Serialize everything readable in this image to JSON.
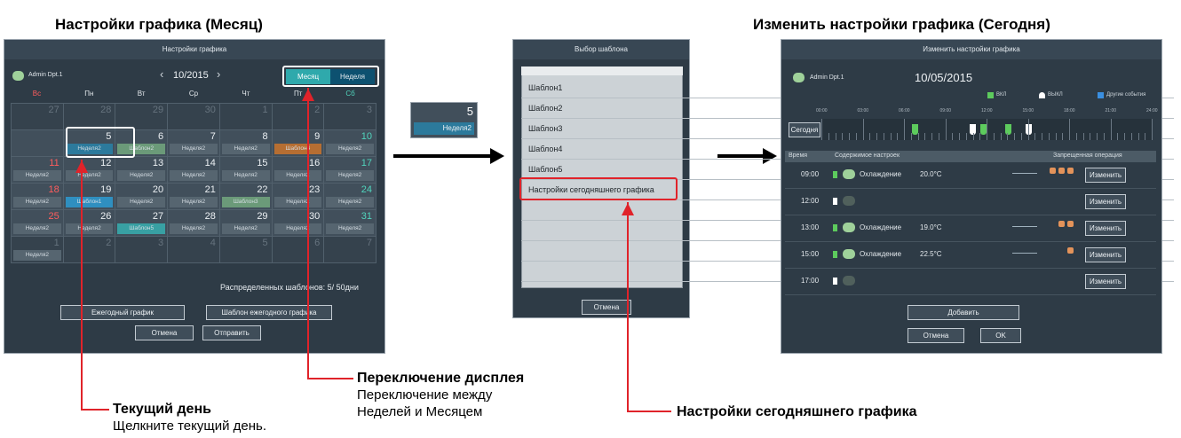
{
  "headings": {
    "month": "Настройки графика (Месяц)",
    "today": "Изменить настройки графика (Сегодня)"
  },
  "cal": {
    "title": "Настройки графика",
    "group": "Admin Dpt.1",
    "month": "10/2015",
    "view_month": "Месяц",
    "view_week": "Неделя",
    "days": [
      "Вс",
      "Пн",
      "Вт",
      "Ср",
      "Чт",
      "Пт",
      "Сб"
    ],
    "footer": "Распределенных шаблонов: 5/ 50дни",
    "btn_yearly": "Ежегодный график",
    "btn_template": "Шаблон ежегодного графика",
    "btn_cancel": "Отмена",
    "btn_send": "Отправить",
    "cells": [
      {
        "n": "27",
        "dim": true
      },
      {
        "n": "28",
        "dim": true
      },
      {
        "n": "29",
        "dim": true
      },
      {
        "n": "30",
        "dim": true
      },
      {
        "n": "1",
        "dim": true
      },
      {
        "n": "2",
        "dim": true
      },
      {
        "n": "3",
        "dim": true
      },
      {
        "n": ""
      },
      {
        "n": "5",
        "label": "Неделя2"
      },
      {
        "n": "6",
        "label": "Шаблон2",
        "c": "green"
      },
      {
        "n": "7",
        "label": "Неделя2"
      },
      {
        "n": "8",
        "label": "Неделя2"
      },
      {
        "n": "9",
        "label": "Шаблон4",
        "c": "orange"
      },
      {
        "n": "10",
        "label": "Неделя2"
      },
      {
        "n": "11",
        "label": "Неделя2"
      },
      {
        "n": "12",
        "label": "Неделя2"
      },
      {
        "n": "13",
        "label": "Неделя2"
      },
      {
        "n": "14",
        "label": "Неделя2"
      },
      {
        "n": "15",
        "label": "Неделя2"
      },
      {
        "n": "16",
        "label": "Неделя2"
      },
      {
        "n": "17",
        "label": "Неделя2"
      },
      {
        "n": "18",
        "label": "Неделя2"
      },
      {
        "n": "19",
        "label": "Шаблон1",
        "c": "blue"
      },
      {
        "n": "20",
        "label": "Неделя2"
      },
      {
        "n": "21",
        "label": "Неделя2"
      },
      {
        "n": "22",
        "label": "Шаблон3",
        "c": "green"
      },
      {
        "n": "23",
        "label": "Неделя2"
      },
      {
        "n": "24",
        "label": "Неделя2"
      },
      {
        "n": "25",
        "label": "Неделя2"
      },
      {
        "n": "26",
        "label": "Неделя2"
      },
      {
        "n": "27",
        "label": "Шаблон5",
        "c": "teal"
      },
      {
        "n": "28",
        "label": "Неделя2"
      },
      {
        "n": "29",
        "label": "Неделя2"
      },
      {
        "n": "30",
        "label": "Неделя2"
      },
      {
        "n": "31",
        "label": "Неделя2"
      },
      {
        "n": "1",
        "dim": true,
        "label": "Неделя2"
      },
      {
        "n": "2",
        "dim": true
      },
      {
        "n": "3",
        "dim": true
      },
      {
        "n": "4",
        "dim": true
      },
      {
        "n": "5",
        "dim": true
      },
      {
        "n": "6",
        "dim": true
      },
      {
        "n": "7",
        "dim": true
      }
    ]
  },
  "zoom": {
    "day": "5",
    "label": "Неделя2"
  },
  "tpl": {
    "title": "Выбор шаблона",
    "items": [
      "Шаблон1",
      "Шаблон2",
      "Шаблон3",
      "Шаблон4",
      "Шаблон5",
      "Настройки сегодняшнего графика"
    ],
    "cancel": "Отмена"
  },
  "today": {
    "title": "Изменить настройки графика",
    "group": "Admin Dpt.1",
    "date": "10/05/2015",
    "leg_on": "ВКЛ",
    "leg_off": "ВЫКЛ",
    "leg_other": "Другие события",
    "ticks": [
      "00:00",
      "03:00",
      "06:00",
      "09:00",
      "12:00",
      "15:00",
      "18:00",
      "21:00",
      "24:00"
    ],
    "today_btn": "Сегодня",
    "col_time": "Время",
    "col_content": "Содержимое настроек",
    "col_forbid": "Запрещенная операция",
    "rows": [
      {
        "t": "09:00",
        "mode": "Охлаждение",
        "temp": "20.0°C"
      },
      {
        "t": "12:00",
        "mode": "",
        "temp": ""
      },
      {
        "t": "13:00",
        "mode": "Охлаждение",
        "temp": "19.0°C"
      },
      {
        "t": "15:00",
        "mode": "Охлаждение",
        "temp": "22.5°C"
      },
      {
        "t": "17:00",
        "mode": "",
        "temp": ""
      }
    ],
    "change": "Изменить",
    "add": "Добавить",
    "cancel": "Отмена",
    "ok": "OK"
  },
  "notes": {
    "switch_title": "Переключение дисплея",
    "switch_desc1": "Переключение между",
    "switch_desc2": "Неделей и Месяцем",
    "day_title": "Текущий день",
    "day_desc": "Щелкните текущий день.",
    "today_title": "Настройки сегодняшнего графика"
  }
}
